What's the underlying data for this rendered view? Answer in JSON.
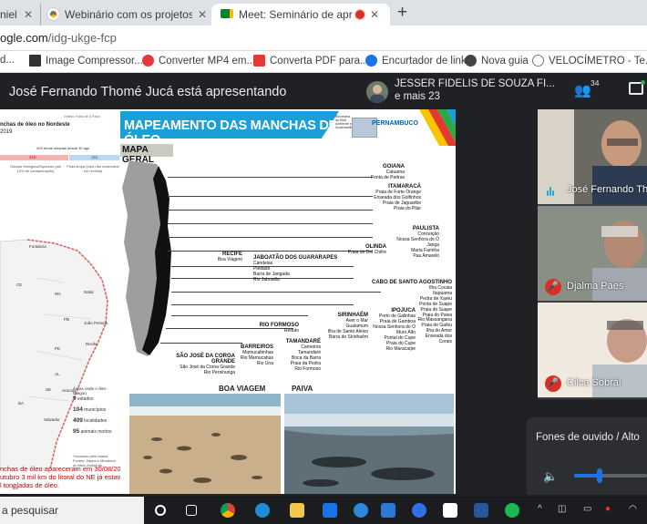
{
  "browser": {
    "tabs": [
      {
        "label": "niel"
      },
      {
        "label": "Webinário com os projetos do Ec"
      },
      {
        "label": "Meet: Seminário de apresent"
      }
    ],
    "new_tab": "+",
    "url_host": "ogle.com",
    "url_path": "/idg-ukge-fcp",
    "bookmarks": [
      {
        "label": "d...",
        "color": "#888888"
      },
      {
        "label": "Image Compressor...",
        "color": "#333333"
      },
      {
        "label": "Converter MP4 em...",
        "color": "#e53935"
      },
      {
        "label": "Converta PDF para...",
        "color": "#e53935"
      },
      {
        "label": "Encurtador de link",
        "color": "#1a73e8"
      },
      {
        "label": "Nova guia",
        "color": "#444444"
      },
      {
        "label": "VELOCÍMETRO - Te...",
        "color": "#777777"
      }
    ]
  },
  "meet": {
    "presenting": "José Fernando Thomé Jucá está apresentando",
    "speaker_name": "JESSER FIDELIS DE SOUZA FI...",
    "speaker_more": "e mais 23",
    "people_count": "34",
    "participants": [
      {
        "name": "José Fernando Th",
        "muted": false
      },
      {
        "name": "Djalma Paes",
        "muted": true
      },
      {
        "name": "Cilca Sobral",
        "muted": true
      }
    ],
    "audio_label": "Fones de ouvido / Alto",
    "volume": 0.35
  },
  "slide": {
    "title": "MAPEAMENTO DAS MANCHAS DE ÓLEO",
    "section": "MAPA GERAL",
    "state_logo": "PERNAMBUCO",
    "logo_small": "Secretaria de Meio Ambiente e Sustentabilidade",
    "left_title": "nchas de óleo no Nordeste",
    "left_year": "2019",
    "left_areas": "409 áreas oleadas desde 30 ago",
    "left_n1": "218",
    "left_n2": "161",
    "left_cap1": "Oleada Vestígios/Esparsos (até 10% de contaminação)",
    "left_cap2": "Praia limpa (óleo não observado em revisita)",
    "left_header_small": "Gráfico: Folha de S.Paulo",
    "cities": [
      "Fortaleza",
      "CE",
      "RN",
      "Natal",
      "João Pessoa",
      "PB",
      "PE",
      "Recife",
      "AL",
      "SE",
      "Aracaju",
      "BA",
      "Salvador",
      "ES"
    ],
    "stats_title": "Áreas onde o óleo chegou",
    "stats": [
      {
        "n": "9",
        "t": "estados"
      },
      {
        "n": "104",
        "t": "municípios"
      },
      {
        "n": "409",
        "t": "localidades"
      },
      {
        "n": "95",
        "t": "animais mortos"
      }
    ],
    "note": "*Incluindo pele Ibama Fontes: Ibama e Ministério do Meio Ambiente",
    "red_line1": "nchas de óleo apareceram em 30/08/2019",
    "red_line2": "utubro 3 mil km do litoral do NE já estava",
    "red_line3": "l toneladas de óleo.",
    "locations": [
      {
        "head": "GOIANA",
        "items": [
          "Catuama",
          "Ponta de Pedras"
        ]
      },
      {
        "head": "ITAMARACÁ",
        "items": [
          "Praia de Forte Orange",
          "Enseada dos Golfinhos",
          "Praia de Jaguaribe",
          "Praia do Pilar"
        ]
      },
      {
        "head": "PAULISTA",
        "items": [
          "Conceição",
          "Nossa Senhora do Ó",
          "Janga",
          "Maria Farinha",
          "Pau Amarelo"
        ]
      },
      {
        "head": "OLINDA",
        "items": [
          "Praia de Del Chifre"
        ]
      },
      {
        "head": "RECIFE",
        "items": [
          "Boa Viagem"
        ]
      },
      {
        "head": "JABOATÃO DOS GUARARAPES",
        "items": [
          "Candeias",
          "Piedade",
          "Barra de Jangada",
          "Rio Jaboatão"
        ]
      },
      {
        "head": "CABO DE SANTO AGOSTINHO",
        "items": [
          "Ilha Cocaia",
          "Itapuama",
          "Pedra de Xaréu",
          "Ponta de Suape",
          "Praia de Suape",
          "Praia do Paiva"
        ]
      },
      {
        "head": "IPOJUCA",
        "items": [
          "Porto de Galinhas",
          "Praia de Gamboa",
          "Nossa Senhora do Ó",
          "Muro Alto",
          "Pontal do Cupe",
          "Praia do Cupe",
          "Rio Maracaípe"
        ]
      },
      {
        "head": "",
        "items": [
          "Rio Massangana",
          "Praia de Gaíbu",
          "Ilha do Amor",
          "Enseada dos Corais"
        ]
      },
      {
        "head": "SIRINHAÉM",
        "items": [
          "Aver o Mar",
          "Gualamum",
          "Ilha de Santo Aleixo",
          "Barra de Sirinhaém"
        ]
      },
      {
        "head": "RIO FORMOSO",
        "items": [
          "Reduto"
        ]
      },
      {
        "head": "TAMANDARÉ",
        "items": [
          "Carneiros",
          "Tamandaré",
          "Boca da Barra",
          "Praia da Pedra",
          "Rio Formoso"
        ]
      },
      {
        "head": "BARREIROS",
        "items": [
          "Mamucabinhas",
          "Rio Mamucabas",
          "Rio Una"
        ]
      },
      {
        "head": "SÃO JOSÉ DA COROA GRANDE",
        "items": [
          "São José da Coroa Grande",
          "Rio Persinunga"
        ]
      }
    ],
    "photo1": "BOA VIAGEM",
    "photo2": "PAIVA"
  },
  "taskbar": {
    "search": "a pesquisar"
  }
}
